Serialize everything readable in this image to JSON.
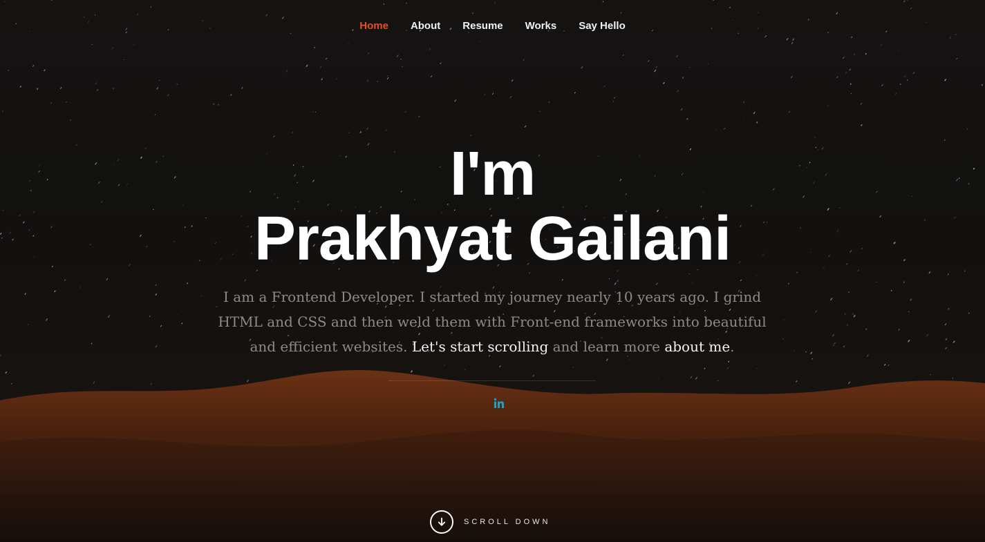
{
  "nav": {
    "items": [
      {
        "label": "Home",
        "active": true
      },
      {
        "label": "About",
        "active": false
      },
      {
        "label": "Resume",
        "active": false
      },
      {
        "label": "Works",
        "active": false
      },
      {
        "label": "Say Hello",
        "active": false
      }
    ]
  },
  "hero": {
    "line1": "I'm",
    "line2": "Prakhyat Gailani",
    "intro_text_1": "I am a Frontend Developer. I started my journey nearly 10 years ago. I grind HTML and CSS and then weld them with Front-end frameworks into beautiful and efficient websites. ",
    "intro_link_1": "Let's start scrolling",
    "intro_text_2": " and learn more ",
    "intro_link_2": "about me",
    "intro_text_3": "."
  },
  "social": {
    "linkedin_icon": "linkedin-icon",
    "linkedin_label": "in"
  },
  "scroll": {
    "label": "SCROLL DOWN",
    "icon": "arrow-down-circle-icon"
  },
  "colors": {
    "accent": "#e8501e",
    "social": "#1aa3c7",
    "text": "#ffffff",
    "muted": "#8e8a86",
    "background": "#121110",
    "dunes": "#5c2a12"
  }
}
